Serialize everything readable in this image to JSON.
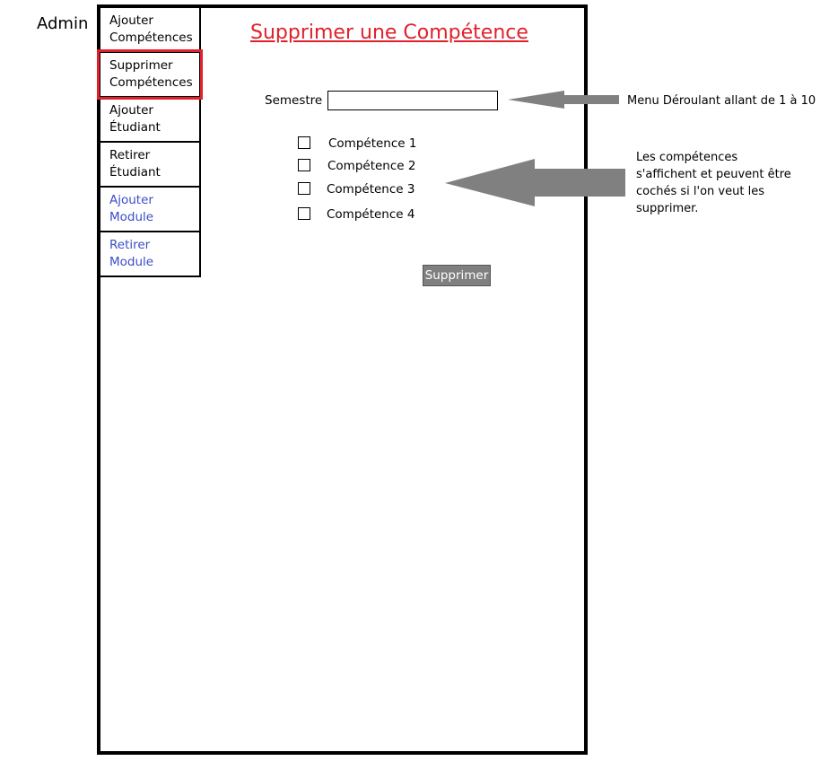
{
  "header": {
    "admin_label": "Admin"
  },
  "sidebar": {
    "items": [
      {
        "label_line1": "Ajouter",
        "label_line2": "Compétences"
      },
      {
        "label_line1": "Supprimer",
        "label_line2": "Compétences"
      },
      {
        "label_line1": "Ajouter",
        "label_line2": "Étudiant"
      },
      {
        "label_line1": "Retirer",
        "label_line2": "Étudiant"
      },
      {
        "label_line1": "Ajouter",
        "label_line2": "Module"
      },
      {
        "label_line1": "Retirer",
        "label_line2": "Module"
      }
    ],
    "active_color": "#e0202c",
    "link_color": "#3b4cc8"
  },
  "main": {
    "title": "Supprimer une Compétence",
    "title_color": "#e0202c",
    "semestre_label": "Semestre",
    "semestre_value": "",
    "competences": [
      {
        "label": "Compétence 1",
        "checked": false
      },
      {
        "label": "Compétence 2",
        "checked": false
      },
      {
        "label": "Compétence 3",
        "checked": false
      },
      {
        "label": "Compétence 4",
        "checked": false
      }
    ],
    "delete_button": "Supprimer"
  },
  "annotations": {
    "dropdown_note": "Menu Déroulant allant de 1 à 10",
    "competences_note": "Les compétences s'affichent et peuvent être cochés si l'on veut les supprimer.",
    "arrow_color": "#808080"
  }
}
